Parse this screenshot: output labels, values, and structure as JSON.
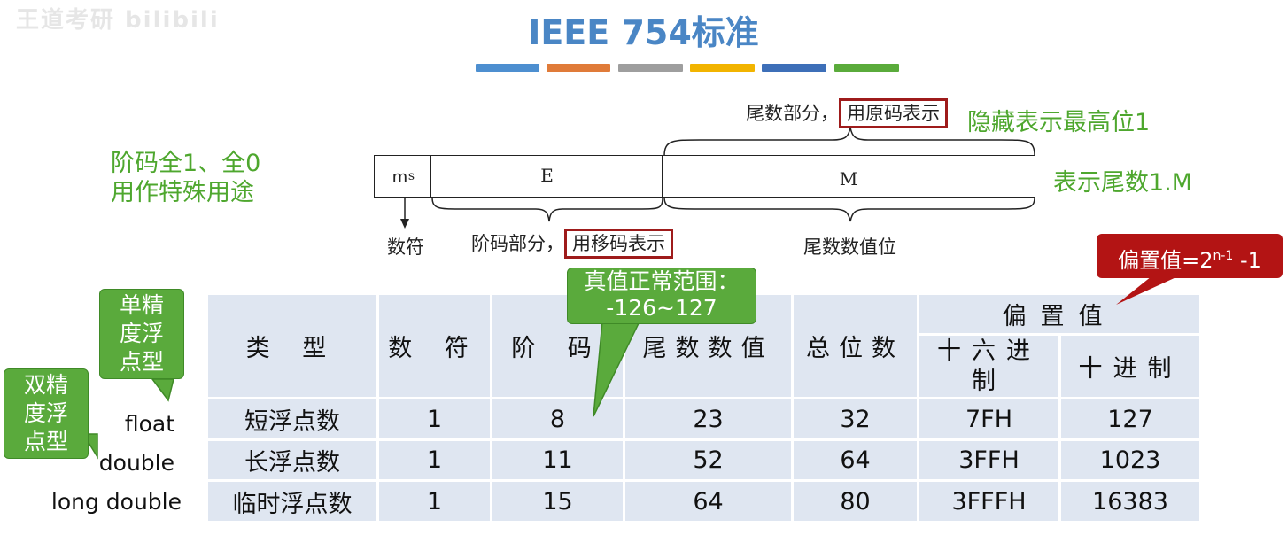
{
  "watermark": "王道考研 bilibili",
  "title": "IEEE 754标准",
  "color_strip": [
    "#4d8fd0",
    "#e07b39",
    "#9e9e9e",
    "#f2b400",
    "#3d6fb8",
    "#5aab3b"
  ],
  "diagram": {
    "top_label": "尾数部分，",
    "top_boxed": "用原码表示",
    "hidden_note": "隐藏表示最高位1",
    "fields": {
      "ms": "m",
      "ms_sub": "s",
      "e": "E",
      "m": "M"
    },
    "sign_label": "数符",
    "exp_label": "阶码部分，",
    "exp_boxed": "用移码表示",
    "mantissa_label": "尾数数值位",
    "left_note_1": "阶码全1、全0",
    "left_note_2": "用作特殊用途",
    "right_note": "表示尾数1.M"
  },
  "callouts": {
    "range_line1": "真值正常范围：",
    "range_line2": "-126~127",
    "bias_base": "偏置值=2",
    "bias_sup": "n-1",
    "bias_tail": " -1",
    "single": [
      "单精",
      "度浮",
      "点型"
    ],
    "double": [
      "双精",
      "度浮",
      "点型"
    ]
  },
  "table": {
    "headers": {
      "type": "类 型",
      "sign": "数 符",
      "exp": "阶 码",
      "mantissa": "尾数数值",
      "total": "总位数",
      "bias": "偏置值",
      "hex": "十六进制",
      "dec": "十进制"
    },
    "rows": [
      {
        "label": "float",
        "type": "短浮点数",
        "sign": "1",
        "exp": "8",
        "mantissa": "23",
        "total": "32",
        "hex": "7FH",
        "dec": "127"
      },
      {
        "label": "double",
        "type": "长浮点数",
        "sign": "1",
        "exp": "11",
        "mantissa": "52",
        "total": "64",
        "hex": "3FFH",
        "dec": "1023"
      },
      {
        "label": "long double",
        "type": "临时浮点数",
        "sign": "1",
        "exp": "15",
        "mantissa": "64",
        "total": "80",
        "hex": "3FFFH",
        "dec": "16383"
      }
    ]
  }
}
